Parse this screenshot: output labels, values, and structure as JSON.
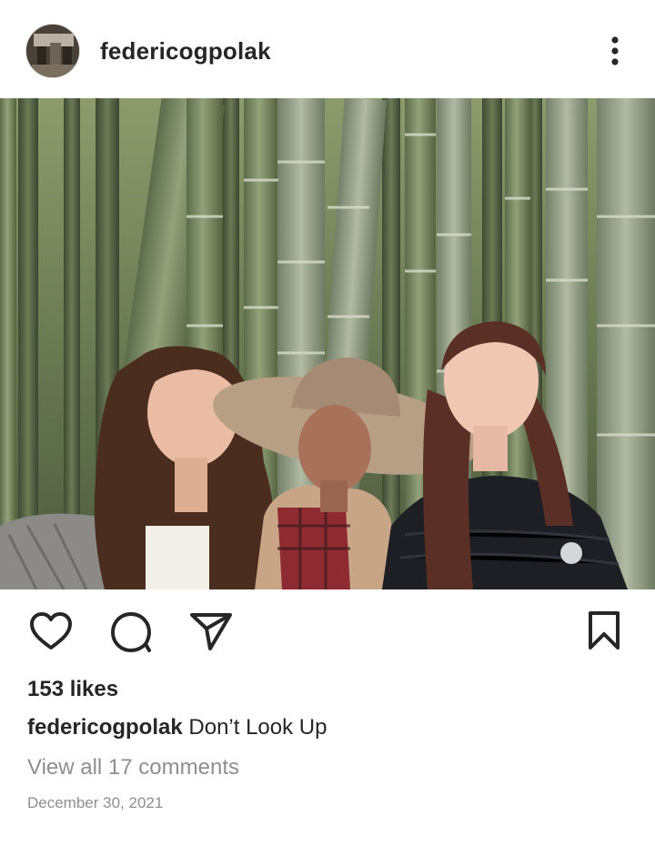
{
  "post": {
    "username": "federicogpolak",
    "likes_text": "153 likes",
    "caption": {
      "username": "federicogpolak",
      "text": "Don’t Look Up"
    },
    "view_comments_text": "View all 17 comments",
    "date": "December 30, 2021"
  },
  "icons": {
    "more": "more-options-icon",
    "like": "heart-icon",
    "comment": "comment-icon",
    "share": "share-icon",
    "save": "bookmark-icon"
  },
  "colors": {
    "text": "#262626",
    "muted": "#8e8e8e",
    "background": "#ffffff"
  }
}
